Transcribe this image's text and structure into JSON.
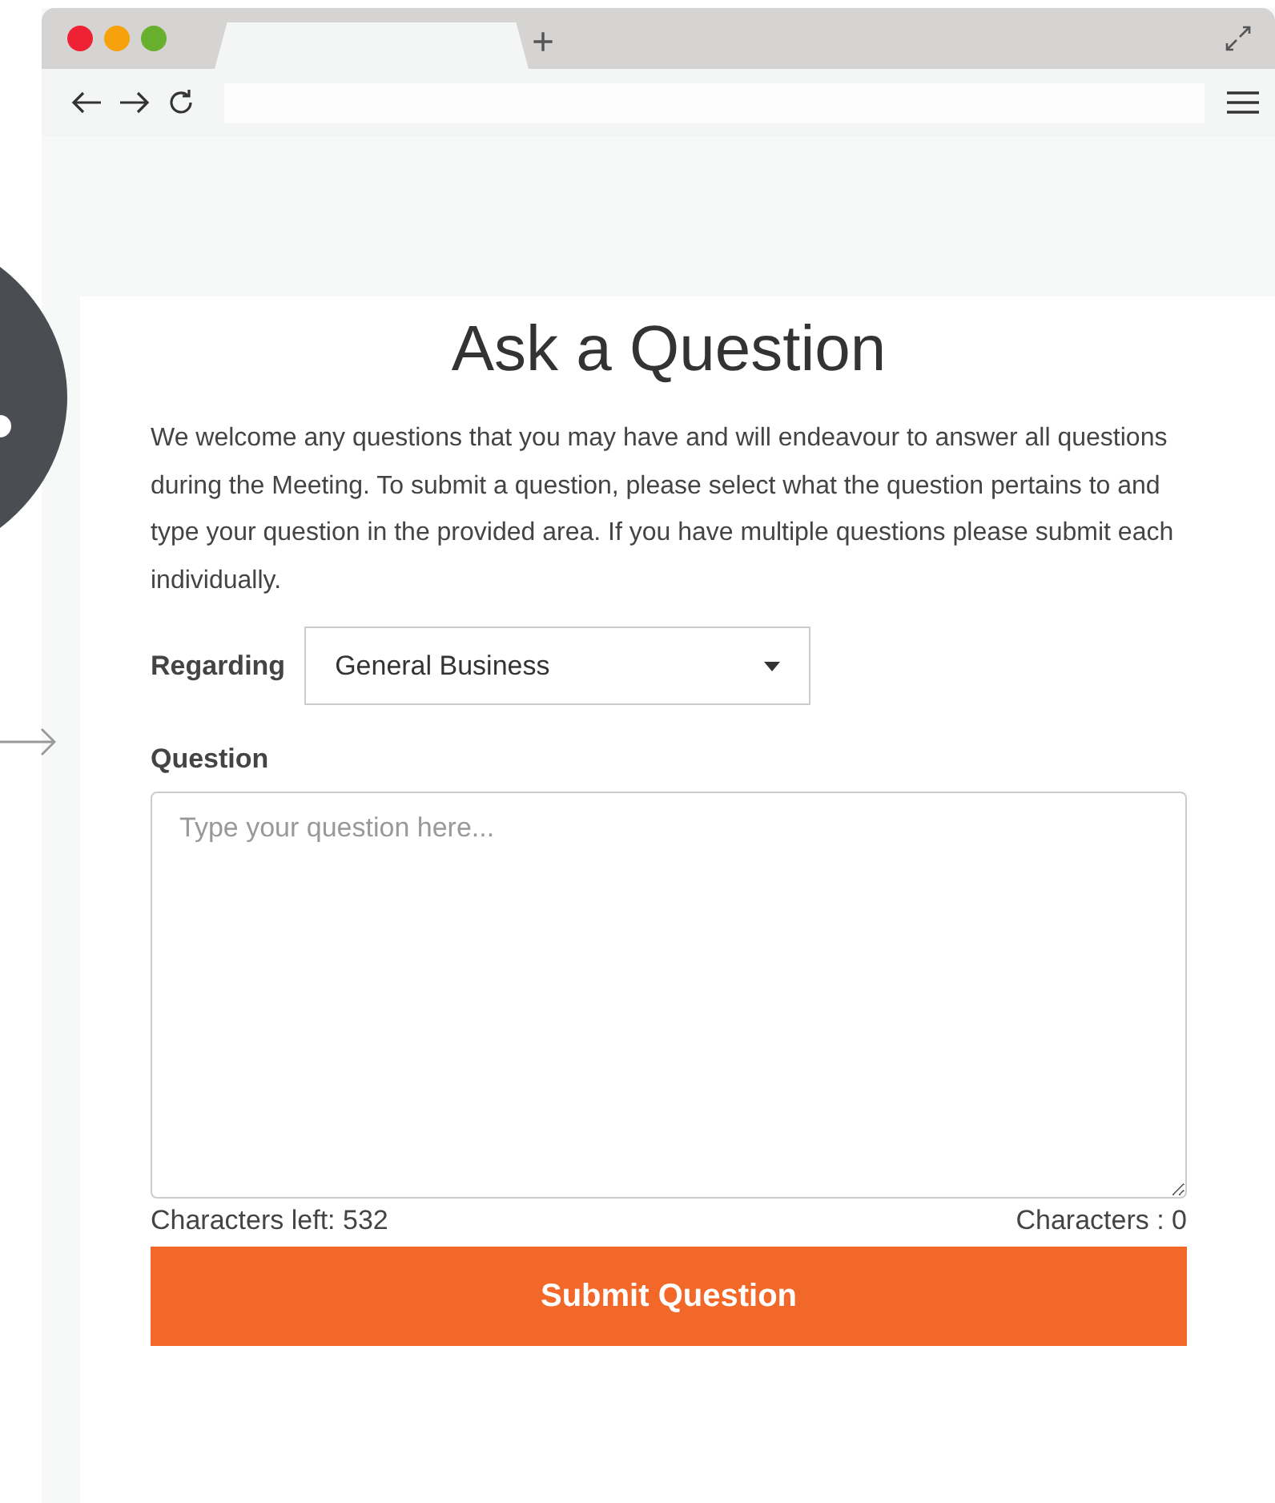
{
  "browser": {
    "new_tab": "+"
  },
  "form": {
    "title": "Ask a Question",
    "intro": "We welcome any questions that you may have and will endeavour to answer all questions during the Meeting. To submit a question, please select what the question pertains to and type your question in the provided area. If you have multiple questions please submit each individually.",
    "regarding": {
      "label": "Regarding",
      "value": "General Business"
    },
    "question": {
      "label": "Question",
      "placeholder": "Type your question here..."
    },
    "characters_left": "Characters left: 532",
    "characters_count": "Characters : 0",
    "submit": "Submit Question"
  }
}
